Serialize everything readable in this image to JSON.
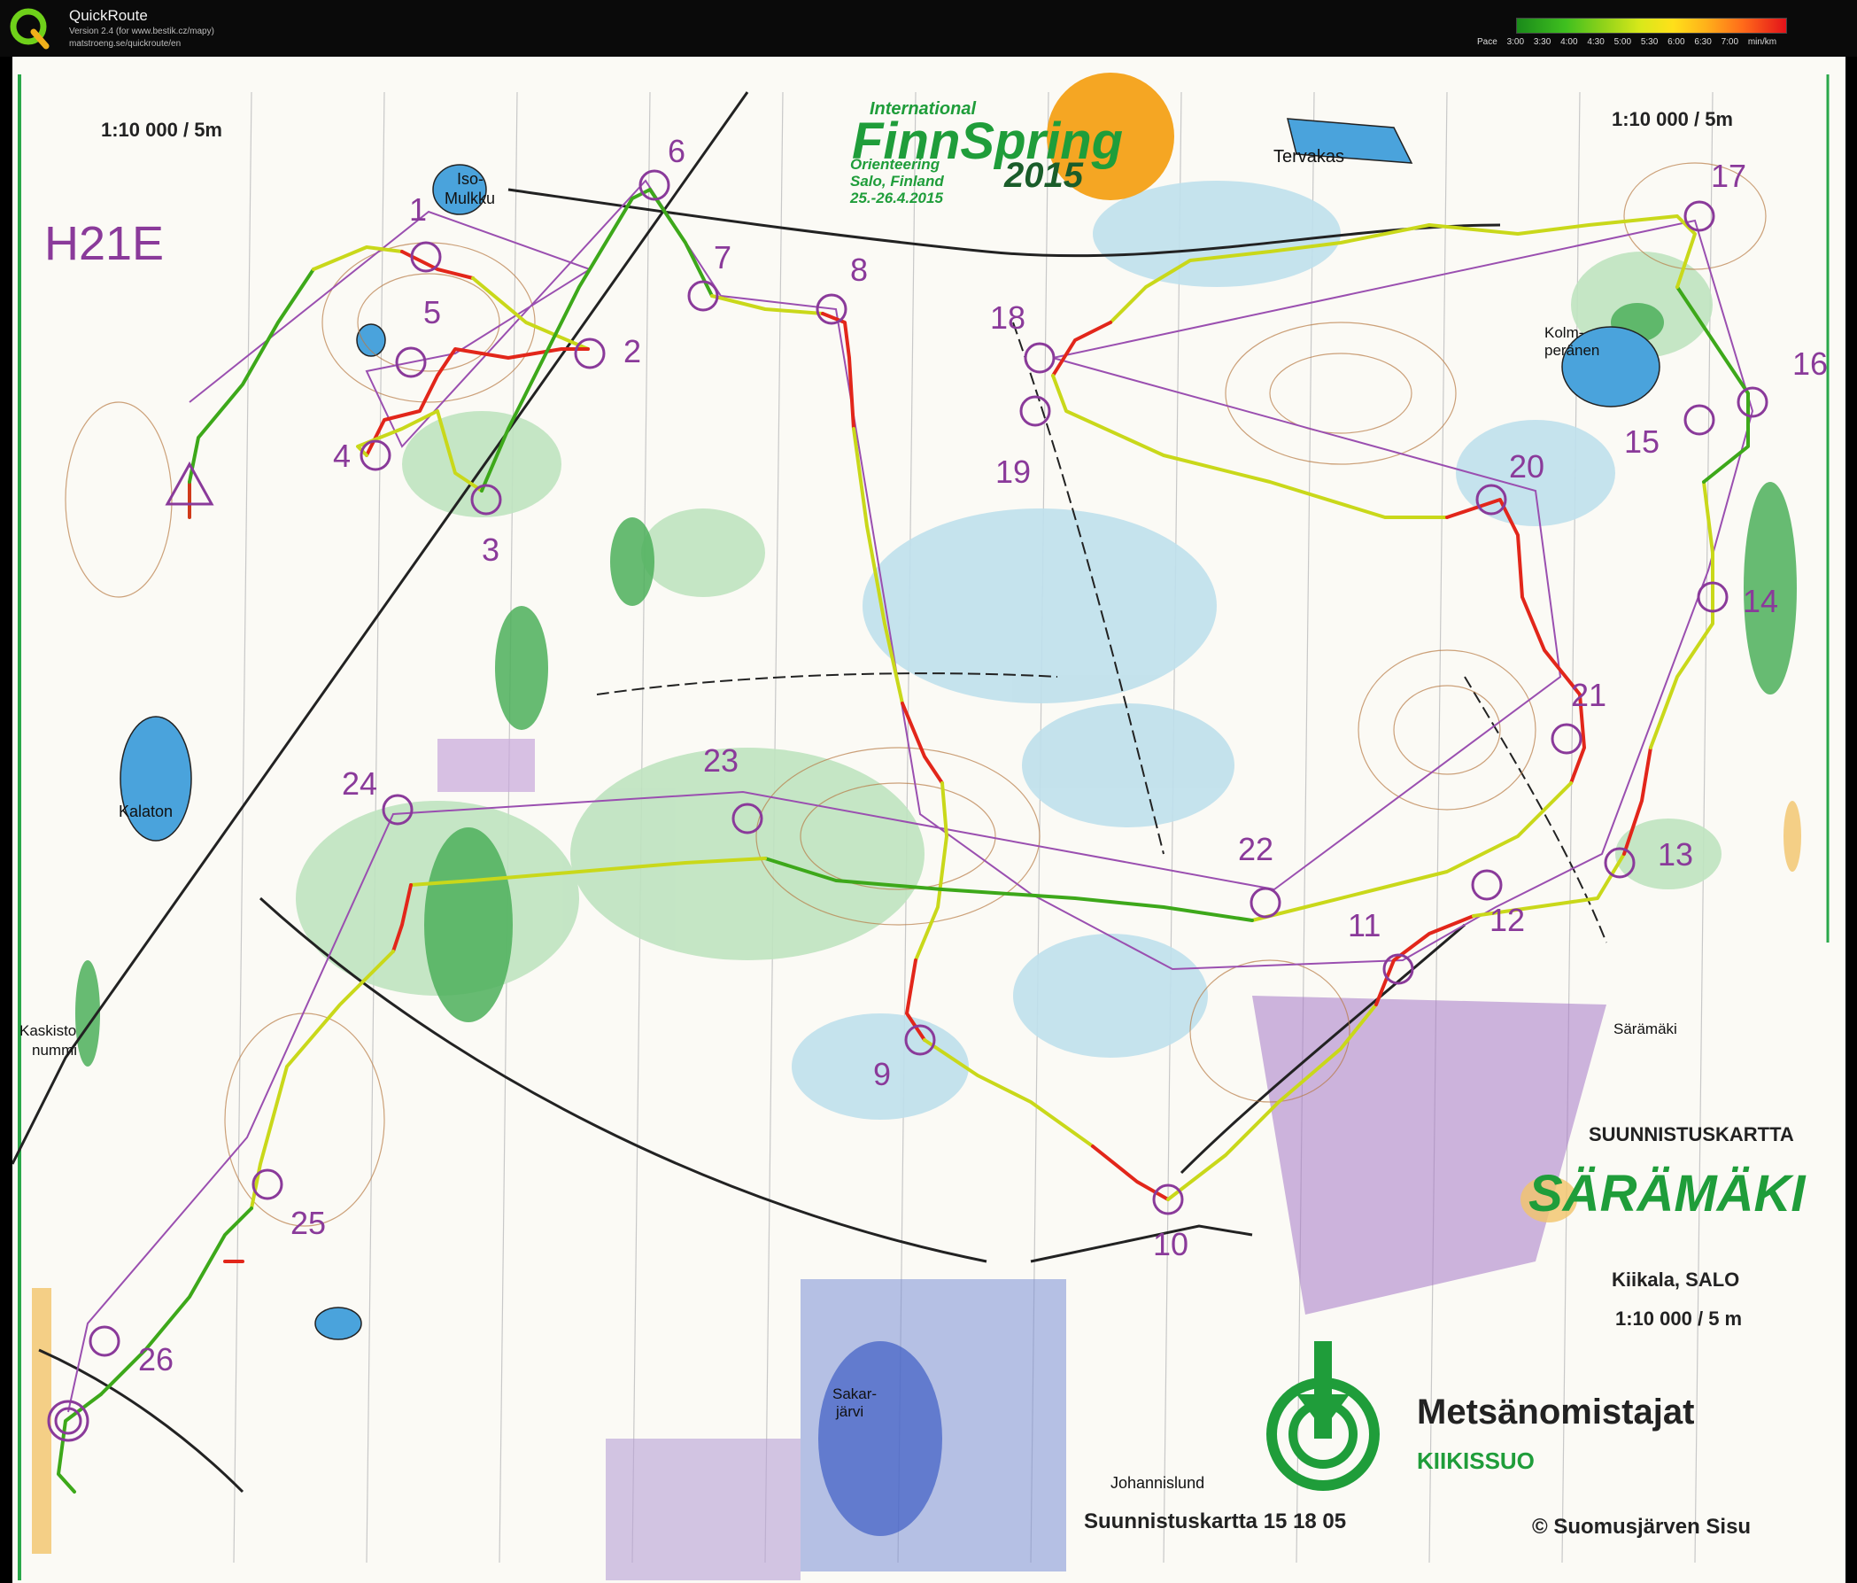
{
  "app": {
    "title": "QuickRoute",
    "version_line": "Version 2.4  (for www.bestik.cz/mapy)",
    "url_line": "matstroeng.se/quickroute/en",
    "logo_letter": "Q"
  },
  "pace_legend": {
    "label": "Pace",
    "ticks": [
      "3:00",
      "3:30",
      "4:00",
      "4:30",
      "5:00",
      "5:30",
      "6:00",
      "6:30",
      "7:00"
    ],
    "unit": "min/km",
    "colors": [
      "#1a8a1a",
      "#8fd21a",
      "#ffe01a",
      "#ff6a1a",
      "#e3121a"
    ]
  },
  "map": {
    "scale_top_left": "1:10 000 / 5m",
    "scale_top_right": "1:10 000 / 5m",
    "class_name": "H21E",
    "event": {
      "intl": "International",
      "name": "FinnSpring",
      "subtitle": "Orienteering",
      "location": "Salo, Finland",
      "dates": "25.-26.4.2015",
      "year": "2015"
    },
    "place_names": {
      "tervakas": "Tervakas",
      "iso_mulkku_1": "Iso-",
      "iso_mulkku_2": "Mulkku",
      "kolmperanen_1": "Kolm-",
      "kolmperanen_2": "peränen",
      "kalaton": "Kalaton",
      "kaskisto_1": "Kaskisto",
      "kaskisto_2": "nummi",
      "saramaki_small": "Särämäki",
      "sakarjarvi_1": "Sakar-",
      "sakarjarvi_2": "järvi",
      "johannislund": "Johannislund"
    },
    "map_label": "SUUNNISTUSKARTTA",
    "map_title": "SÄRÄMÄKI",
    "map_location": "Kiikala, SALO",
    "map_scale": "1:10 000 / 5 m",
    "publisher": "Metsänomistajat",
    "publisher_sub": "KIIKISSUO",
    "map_number": "Suunnistuskartta 15 18 05",
    "copyright": "© Suomusjärven Sisu",
    "controls": [
      "1",
      "2",
      "3",
      "4",
      "5",
      "6",
      "7",
      "8",
      "9",
      "10",
      "11",
      "12",
      "13",
      "14",
      "15",
      "16",
      "17",
      "18",
      "19",
      "20",
      "21",
      "22",
      "23",
      "24",
      "25",
      "26"
    ]
  }
}
